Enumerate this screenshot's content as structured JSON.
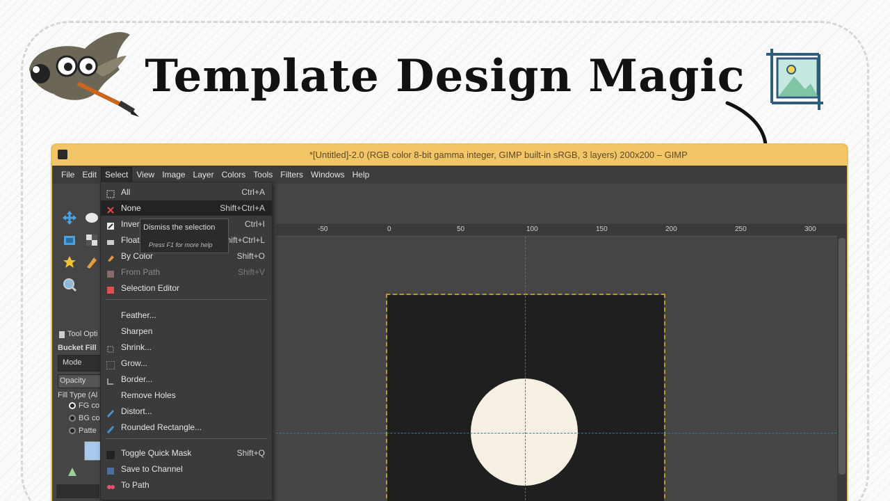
{
  "headline": "Template Design Magic",
  "window": {
    "title": "*[Untitled]-2.0 (RGB color 8-bit gamma integer, GIMP built-in sRGB, 3 layers) 200x200 – GIMP",
    "title_bar_color": "#f2c566"
  },
  "menubar": [
    "File",
    "Edit",
    "Select",
    "View",
    "Image",
    "Layer",
    "Colors",
    "Tools",
    "Filters",
    "Windows",
    "Help"
  ],
  "active_menu": "Select",
  "select_menu": [
    {
      "label": "All",
      "shortcut": "Ctrl+A",
      "icon": "select-all-icon"
    },
    {
      "label": "None",
      "shortcut": "Shift+Ctrl+A",
      "icon": "select-none-icon"
    },
    {
      "label": "Invert",
      "shortcut": "Ctrl+I",
      "icon": "invert-icon"
    },
    {
      "label": "Float",
      "shortcut": "Shift+Ctrl+L",
      "icon": "float-icon"
    },
    {
      "label": "By Color",
      "shortcut": "Shift+O",
      "icon": "by-color-icon"
    },
    {
      "label": "From Path",
      "shortcut": "Shift+V",
      "icon": "from-path-icon"
    },
    {
      "label": "Selection Editor",
      "shortcut": "",
      "icon": "selection-editor-icon"
    },
    {
      "label": "Feather...",
      "shortcut": "",
      "icon": ""
    },
    {
      "label": "Sharpen",
      "shortcut": "",
      "icon": ""
    },
    {
      "label": "Shrink...",
      "shortcut": "",
      "icon": "shrink-icon"
    },
    {
      "label": "Grow...",
      "shortcut": "",
      "icon": "grow-icon"
    },
    {
      "label": "Border...",
      "shortcut": "",
      "icon": "border-icon"
    },
    {
      "label": "Remove Holes",
      "shortcut": "",
      "icon": ""
    },
    {
      "label": "Distort...",
      "shortcut": "",
      "icon": "distort-icon"
    },
    {
      "label": "Rounded Rectangle...",
      "shortcut": "",
      "icon": "rounded-rectangle-icon"
    },
    {
      "label": "Toggle Quick Mask",
      "shortcut": "Shift+Q",
      "icon": "quick-mask-icon"
    },
    {
      "label": "Save to Channel",
      "shortcut": "",
      "icon": "save-channel-icon"
    },
    {
      "label": "To Path",
      "shortcut": "",
      "icon": "to-path-icon"
    }
  ],
  "tooltip": {
    "text": "Dismiss the selection",
    "hint": "Press F1 for more help"
  },
  "tool_options": {
    "tab_label": "Tool Opti",
    "tool_name": "Bucket Fill",
    "mode_label": "Mode",
    "opacity_label": "Opacity",
    "fill_type_label": "Fill Type (Al",
    "radio_fg": "FG co",
    "radio_bg": "BG co",
    "radio_pattern": "Patte"
  },
  "ruler": {
    "ticks": [
      "-50",
      "0",
      "50",
      "100",
      "150",
      "200",
      "250",
      "300"
    ]
  }
}
